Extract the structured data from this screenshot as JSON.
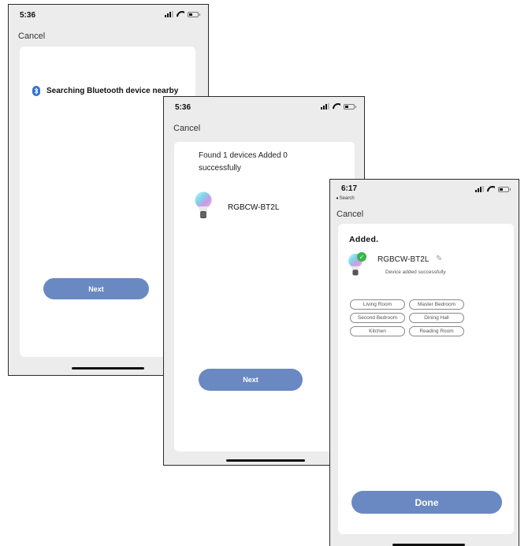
{
  "screen1": {
    "time": "5:36",
    "cancel": "Cancel",
    "searching_text": "Searching Bluetooth device nearby",
    "next_label": "Next"
  },
  "screen2": {
    "time": "5:36",
    "cancel": "Cancel",
    "found_text": "Found 1 devices Added 0 successfully",
    "device_name": "RGBCW-BT2L",
    "next_label": "Next"
  },
  "screen3": {
    "time": "6:17",
    "back_label": "◂ Search",
    "cancel": "Cancel",
    "added_title": "Added.",
    "device_name": "RGBCW-BT2L",
    "device_status": "Device added successfully",
    "rooms": [
      "Living Room",
      "Master Bedroom",
      "Second Bedroom",
      "Dining Hall",
      "Kitchen",
      "Reading Room"
    ],
    "done_label": "Done"
  },
  "colors": {
    "button_blue": "#6a89c2",
    "bluetooth_blue": "#2f6fd0",
    "success_green": "#39b34a"
  },
  "icons": [
    "bluetooth-icon",
    "bulb-icon",
    "check-icon",
    "pencil-icon",
    "signal-icon",
    "wifi-icon",
    "battery-icon",
    "location-arrow-icon"
  ]
}
